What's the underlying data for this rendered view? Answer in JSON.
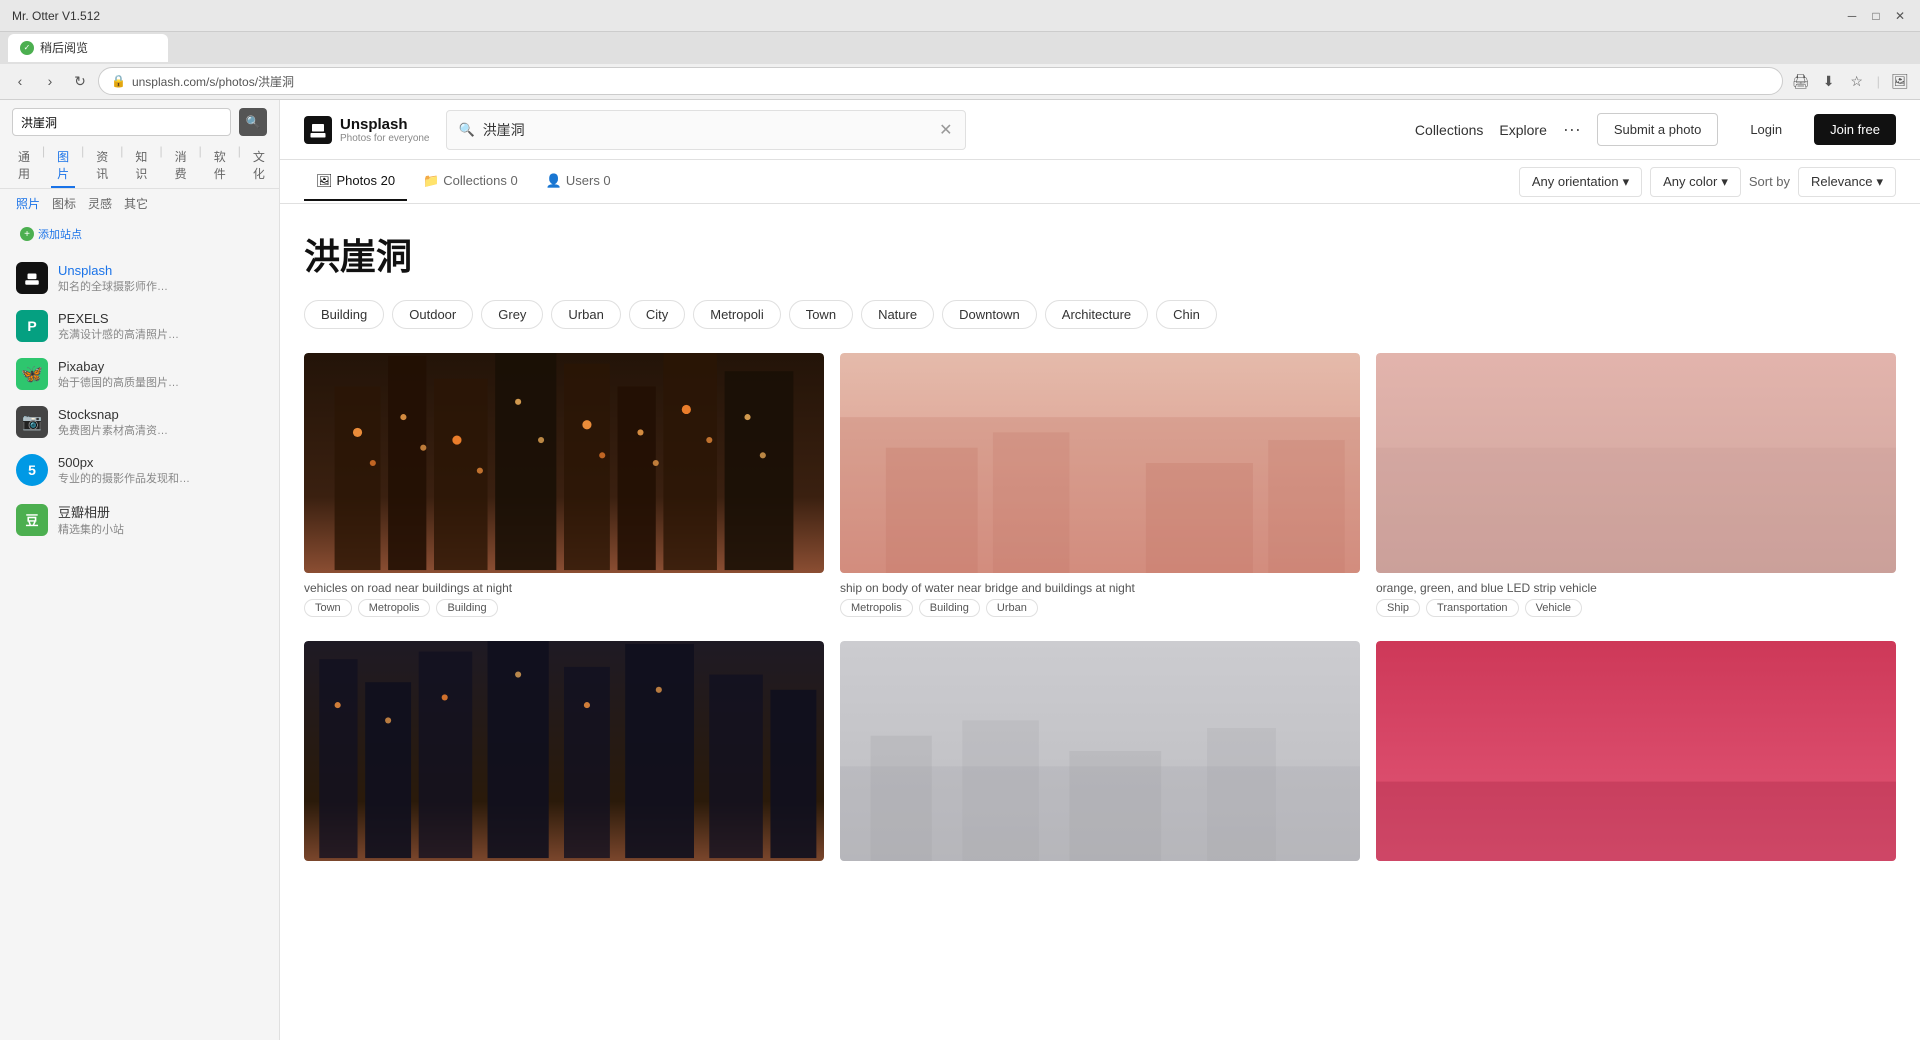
{
  "titleBar": {
    "title": "Mr. Otter V1.512",
    "controls": [
      "minimize",
      "maximize",
      "close"
    ]
  },
  "browserTab": {
    "label": "稍后阅览",
    "iconColor": "#4CAF50"
  },
  "addressBar": {
    "url": ""
  },
  "sidebar": {
    "searchValue": "洪崖洞",
    "searchPlaceholder": "洪崖洞",
    "topTabs": [
      "通用",
      "图片",
      "资讯",
      "知识",
      "消费",
      "软件",
      "文化"
    ],
    "activeTopTab": "图片",
    "subTabs": [
      "照片",
      "图标",
      "灵感",
      "其它"
    ],
    "activeSubTab": "照片",
    "addSiteLabel": "添加站点",
    "sites": [
      {
        "name": "Unsplash",
        "nameClass": "unsplash",
        "desc": "知名的全球摄影师作…",
        "iconBg": "#111",
        "iconColor": "white",
        "iconText": "U",
        "iconShape": "unsplash"
      },
      {
        "name": "PEXELS",
        "nameClass": "",
        "desc": "充满设计感的高清照片…",
        "iconBg": "#05a081",
        "iconColor": "white",
        "iconText": "P",
        "iconShape": "circle"
      },
      {
        "name": "Pixabay",
        "nameClass": "",
        "desc": "始于德国的高质量图片…",
        "iconBg": "#2ec66e",
        "iconColor": "white",
        "iconText": "🦋",
        "iconShape": "circle"
      },
      {
        "name": "Stocksnap",
        "nameClass": "",
        "desc": "免费图片素材高清资…",
        "iconBg": "#333",
        "iconColor": "white",
        "iconText": "📷",
        "iconShape": "circle"
      },
      {
        "name": "500px",
        "nameClass": "",
        "desc": "专业的的摄影作品发现和…",
        "iconBg": "#0099e5",
        "iconColor": "white",
        "iconText": "5",
        "iconShape": "circle"
      },
      {
        "name": "豆瓣相册",
        "nameClass": "",
        "desc": "精选集的小站",
        "iconBg": "#4caf50",
        "iconColor": "white",
        "iconText": "豆",
        "iconShape": "circle"
      }
    ]
  },
  "unsplash": {
    "logo": "Unsplash",
    "tagline": "Photos for everyone",
    "searchValue": "洪崖洞",
    "nav": {
      "collections": "Collections",
      "explore": "Explore",
      "more": "···",
      "submitPhoto": "Submit a photo",
      "login": "Login",
      "joinFree": "Join free"
    },
    "resultTabs": [
      {
        "label": "Photos",
        "count": "20",
        "active": true,
        "icon": "🖼"
      },
      {
        "label": "Collections",
        "count": "0",
        "active": false,
        "icon": "📁"
      },
      {
        "label": "Users",
        "count": "0",
        "active": false,
        "icon": "👤"
      }
    ],
    "filters": {
      "orientation": "Any orientation",
      "color": "Any color",
      "sortBy": "Sort by",
      "sortValue": "Relevance"
    },
    "searchTitle": "洪崖洞",
    "tags": [
      "Building",
      "Outdoor",
      "Grey",
      "Urban",
      "City",
      "Metropoli",
      "Town",
      "Nature",
      "Downtown",
      "Architecture",
      "Chin"
    ],
    "photos": [
      {
        "id": "photo1",
        "topColor": "#2a1a0a",
        "bottomColor": "#c9714d",
        "gradientStop": 65,
        "caption": "vehicles on road near buildings at night",
        "tags": [
          "Town",
          "Metropolis",
          "Building"
        ],
        "style": "dark-orange"
      },
      {
        "id": "photo2",
        "topColor": "#e8c5b8",
        "bottomColor": "#d4867a",
        "gradientStop": 60,
        "caption": "ship on body of water near bridge and buildings at night",
        "tags": [
          "Metropolis",
          "Building",
          "Urban"
        ],
        "style": "pink-light"
      },
      {
        "id": "photo3",
        "topColor": "#e8b8b0",
        "bottomColor": "#c9a09a",
        "gradientStop": 60,
        "caption": "orange, green, and blue LED strip vehicle",
        "tags": [
          "Ship",
          "Transportation",
          "Vehicle"
        ],
        "style": "pink-medium"
      },
      {
        "id": "photo4",
        "topColor": "#1a1a2e",
        "bottomColor": "#c9714d",
        "gradientStop": 65,
        "caption": "",
        "tags": [],
        "style": "dark-orange2"
      },
      {
        "id": "photo5",
        "topColor": "#c8c8cc",
        "bottomColor": "#b8b8bc",
        "gradientStop": 60,
        "caption": "",
        "tags": [],
        "style": "grey-light"
      },
      {
        "id": "photo6",
        "topColor": "#d44060",
        "bottomColor": "#e8607a",
        "gradientStop": 60,
        "caption": "",
        "tags": [],
        "style": "pink-red"
      }
    ]
  }
}
